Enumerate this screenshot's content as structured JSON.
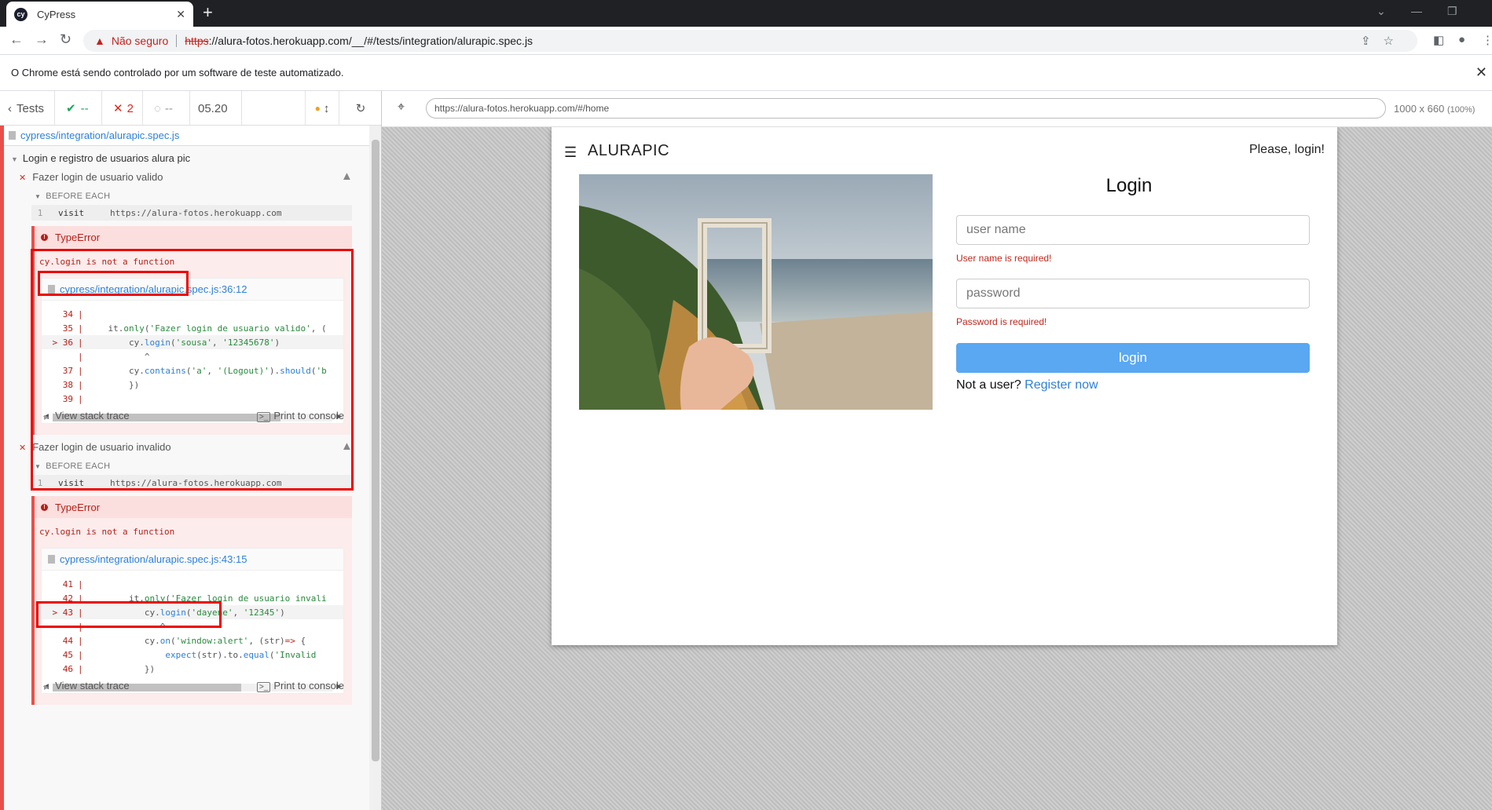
{
  "browser": {
    "tab_title": "CyPress",
    "tab_favicon": "cy",
    "not_secure": "Não seguro",
    "url_scheme": "https",
    "url_rest": "://alura-fotos.herokuapp.com/__/#/tests/integration/alurapic.spec.js",
    "automation_notice": "O Chrome está sendo controlado por um software de teste automatizado."
  },
  "reporter": {
    "back_label": "Tests",
    "passed": "--",
    "failed": "2",
    "pending": "--",
    "duration": "05.20",
    "spec_file": "cypress/integration/alurapic.spec.js",
    "suite_title": "Login e registro de usuarios alura pic",
    "before_each_label": "BEFORE EACH",
    "tests": [
      {
        "title": "Fazer login de usuario valido",
        "cmd_num": "1",
        "cmd": "visit",
        "cmd_arg": "https://alura-fotos.herokuapp.com",
        "error_type": "TypeError",
        "error_msg": "cy.login is not a function",
        "frame_link": "cypress/integration/alurapic.spec.js:36:12",
        "view_stack": "View stack trace",
        "print_console": "Print to console"
      },
      {
        "title": "Fazer login de usuario invalido",
        "cmd_num": "1",
        "cmd": "visit",
        "cmd_arg": "https://alura-fotos.herokuapp.com",
        "error_type": "TypeError",
        "error_msg": "cy.login is not a function",
        "frame_link": "cypress/integration/alurapic.spec.js:43:15",
        "view_stack": "View stack trace",
        "print_console": "Print to console"
      }
    ]
  },
  "aut": {
    "url": "https://alura-fotos.herokuapp.com/#/home",
    "size": "1000 x 660",
    "scale": "(100%)"
  },
  "app": {
    "brand": "ALURAPIC",
    "please_login": "Please, login!",
    "login_title": "Login",
    "username_placeholder": "user name",
    "username_error": "User name is required!",
    "password_placeholder": "password",
    "password_error": "Password is required!",
    "login_button": "login",
    "not_user": "Not a user?",
    "register_link": "Register now"
  },
  "colors": {
    "passed": "#1fa55a",
    "failed": "#e0271a",
    "link": "#2f80d6",
    "button": "#5aa7f2"
  }
}
